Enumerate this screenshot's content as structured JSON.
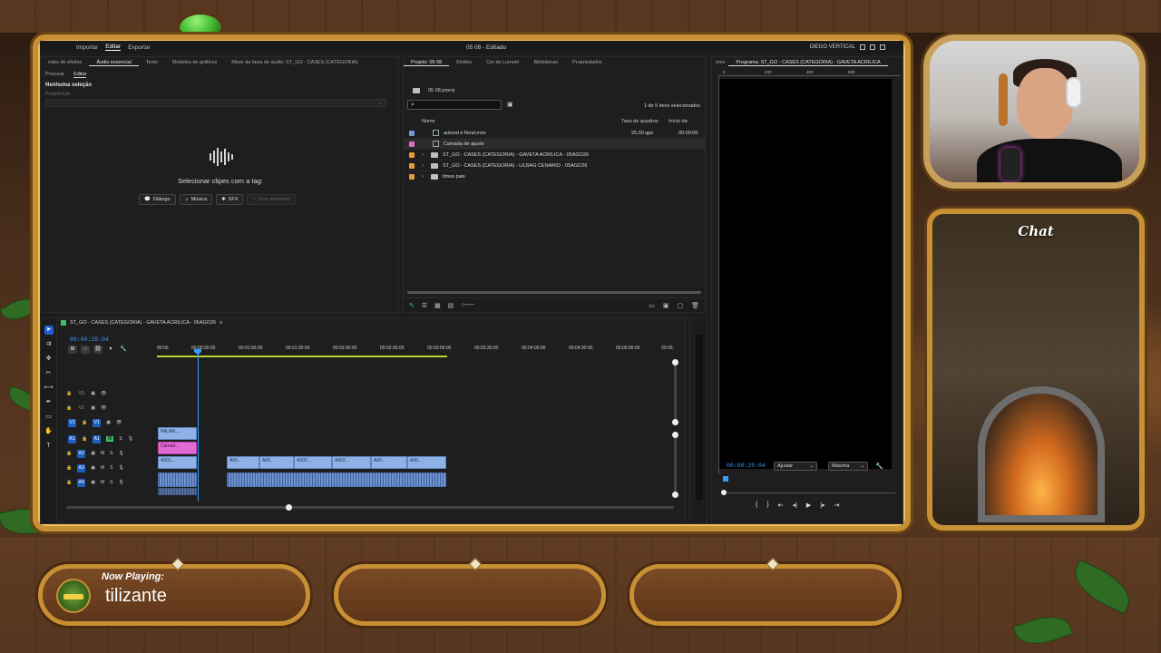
{
  "menubar": {
    "items": [
      "Importar",
      "Editar",
      "Exportar"
    ],
    "active": "Editar",
    "title": "05 08 - Editado",
    "workspace": "DIEGO VERTICAL"
  },
  "essential_sound": {
    "tabs": [
      "roles de efeitos",
      "Áudio essencial",
      "Texto",
      "Modelos de gráficos",
      "Mixer da faixa de áudio: ST_GO - CASES (CATEGORIA)"
    ],
    "subtabs": [
      "Procurar",
      "Editar"
    ],
    "no_selection": "Nenhuma seleção",
    "preset_label": "Predefinição",
    "prompt": "Selecionar clipes com a tag:",
    "tags": [
      "Diálogo",
      "Música",
      "SFX",
      "Som ambiente"
    ]
  },
  "project": {
    "tabs": [
      "Projeto: 05 08",
      "Efeitos",
      "Cor de Lumetri",
      "Bibliotecas",
      "Propriedades"
    ],
    "path": "05 08.prproj",
    "count": "1 de 5 itens selecionados",
    "columns": [
      "Nome",
      "Taxa de quadros",
      "Início da"
    ],
    "rows": [
      {
        "name": "autoral e floral.mov",
        "rate": "25,00 qps",
        "start": "00:00:00",
        "color": "#6f9ed6",
        "type": "file"
      },
      {
        "name": "Camada de ajuste",
        "rate": "",
        "start": "",
        "color": "#d46fd0",
        "type": "file"
      },
      {
        "name": "ST_GO - CASES (CATEGORIA) - GAVETA ACRILICA - 05AGO26",
        "rate": "",
        "start": "",
        "color": "#e89a3a",
        "type": "folder"
      },
      {
        "name": "ST_GO - CASES (CATEGORIA) - LILBAG CENARIO - 05AGO26",
        "rate": "",
        "start": "",
        "color": "#e89a3a",
        "type": "folder"
      },
      {
        "name": "times pais",
        "rate": "",
        "start": "",
        "color": "#e89a3a",
        "type": "folder"
      }
    ]
  },
  "program": {
    "tabs": [
      "Fonte: autoral e floral.mov",
      "Programa: ST_GO - CASES (CATEGORIA) - GAVETA ACRILICA"
    ],
    "tab_short": "mov",
    "ruler": [
      "0",
      "200",
      "400",
      "600"
    ],
    "timecode": "00:00:25:04",
    "fit": "Ajustar",
    "quality": "Máxima"
  },
  "timeline": {
    "title": "ST_GO - CASES (CATEGORIA) - GAVETA ACRILICA - 05AGO26",
    "timecode": "00:00:25:04",
    "ruler": [
      "00:00",
      "00:00:30:00",
      "00:01:00:00",
      "00:01:30:00",
      "00:02:00:00",
      "00:02:30:00",
      "00:03:00:00",
      "00:03:30:00",
      "00:04:00:00",
      "00:04:30:00",
      "00:05:00:00",
      "00:05:"
    ],
    "tracks_video": [
      "V3",
      "V2",
      "V1"
    ],
    "tracks_audio": [
      "A1",
      "A2",
      "A3",
      "A4"
    ],
    "clips": {
      "v3": "PALME...",
      "v2": "Camad...",
      "v1": [
        "A001...",
        "A00...",
        "A00...",
        "A003...",
        "A002...",
        "A00...",
        "A00..."
      ]
    }
  },
  "overlay": {
    "chat_title": "Chat",
    "now_playing_label": "Now Playing:",
    "now_playing_text": "tilizante"
  },
  "colors": {
    "accent": "#3b9cff",
    "frame_gold": "#c89034",
    "video_clip": "#8fb2e6",
    "adjust_clip": "#e26ad7"
  }
}
